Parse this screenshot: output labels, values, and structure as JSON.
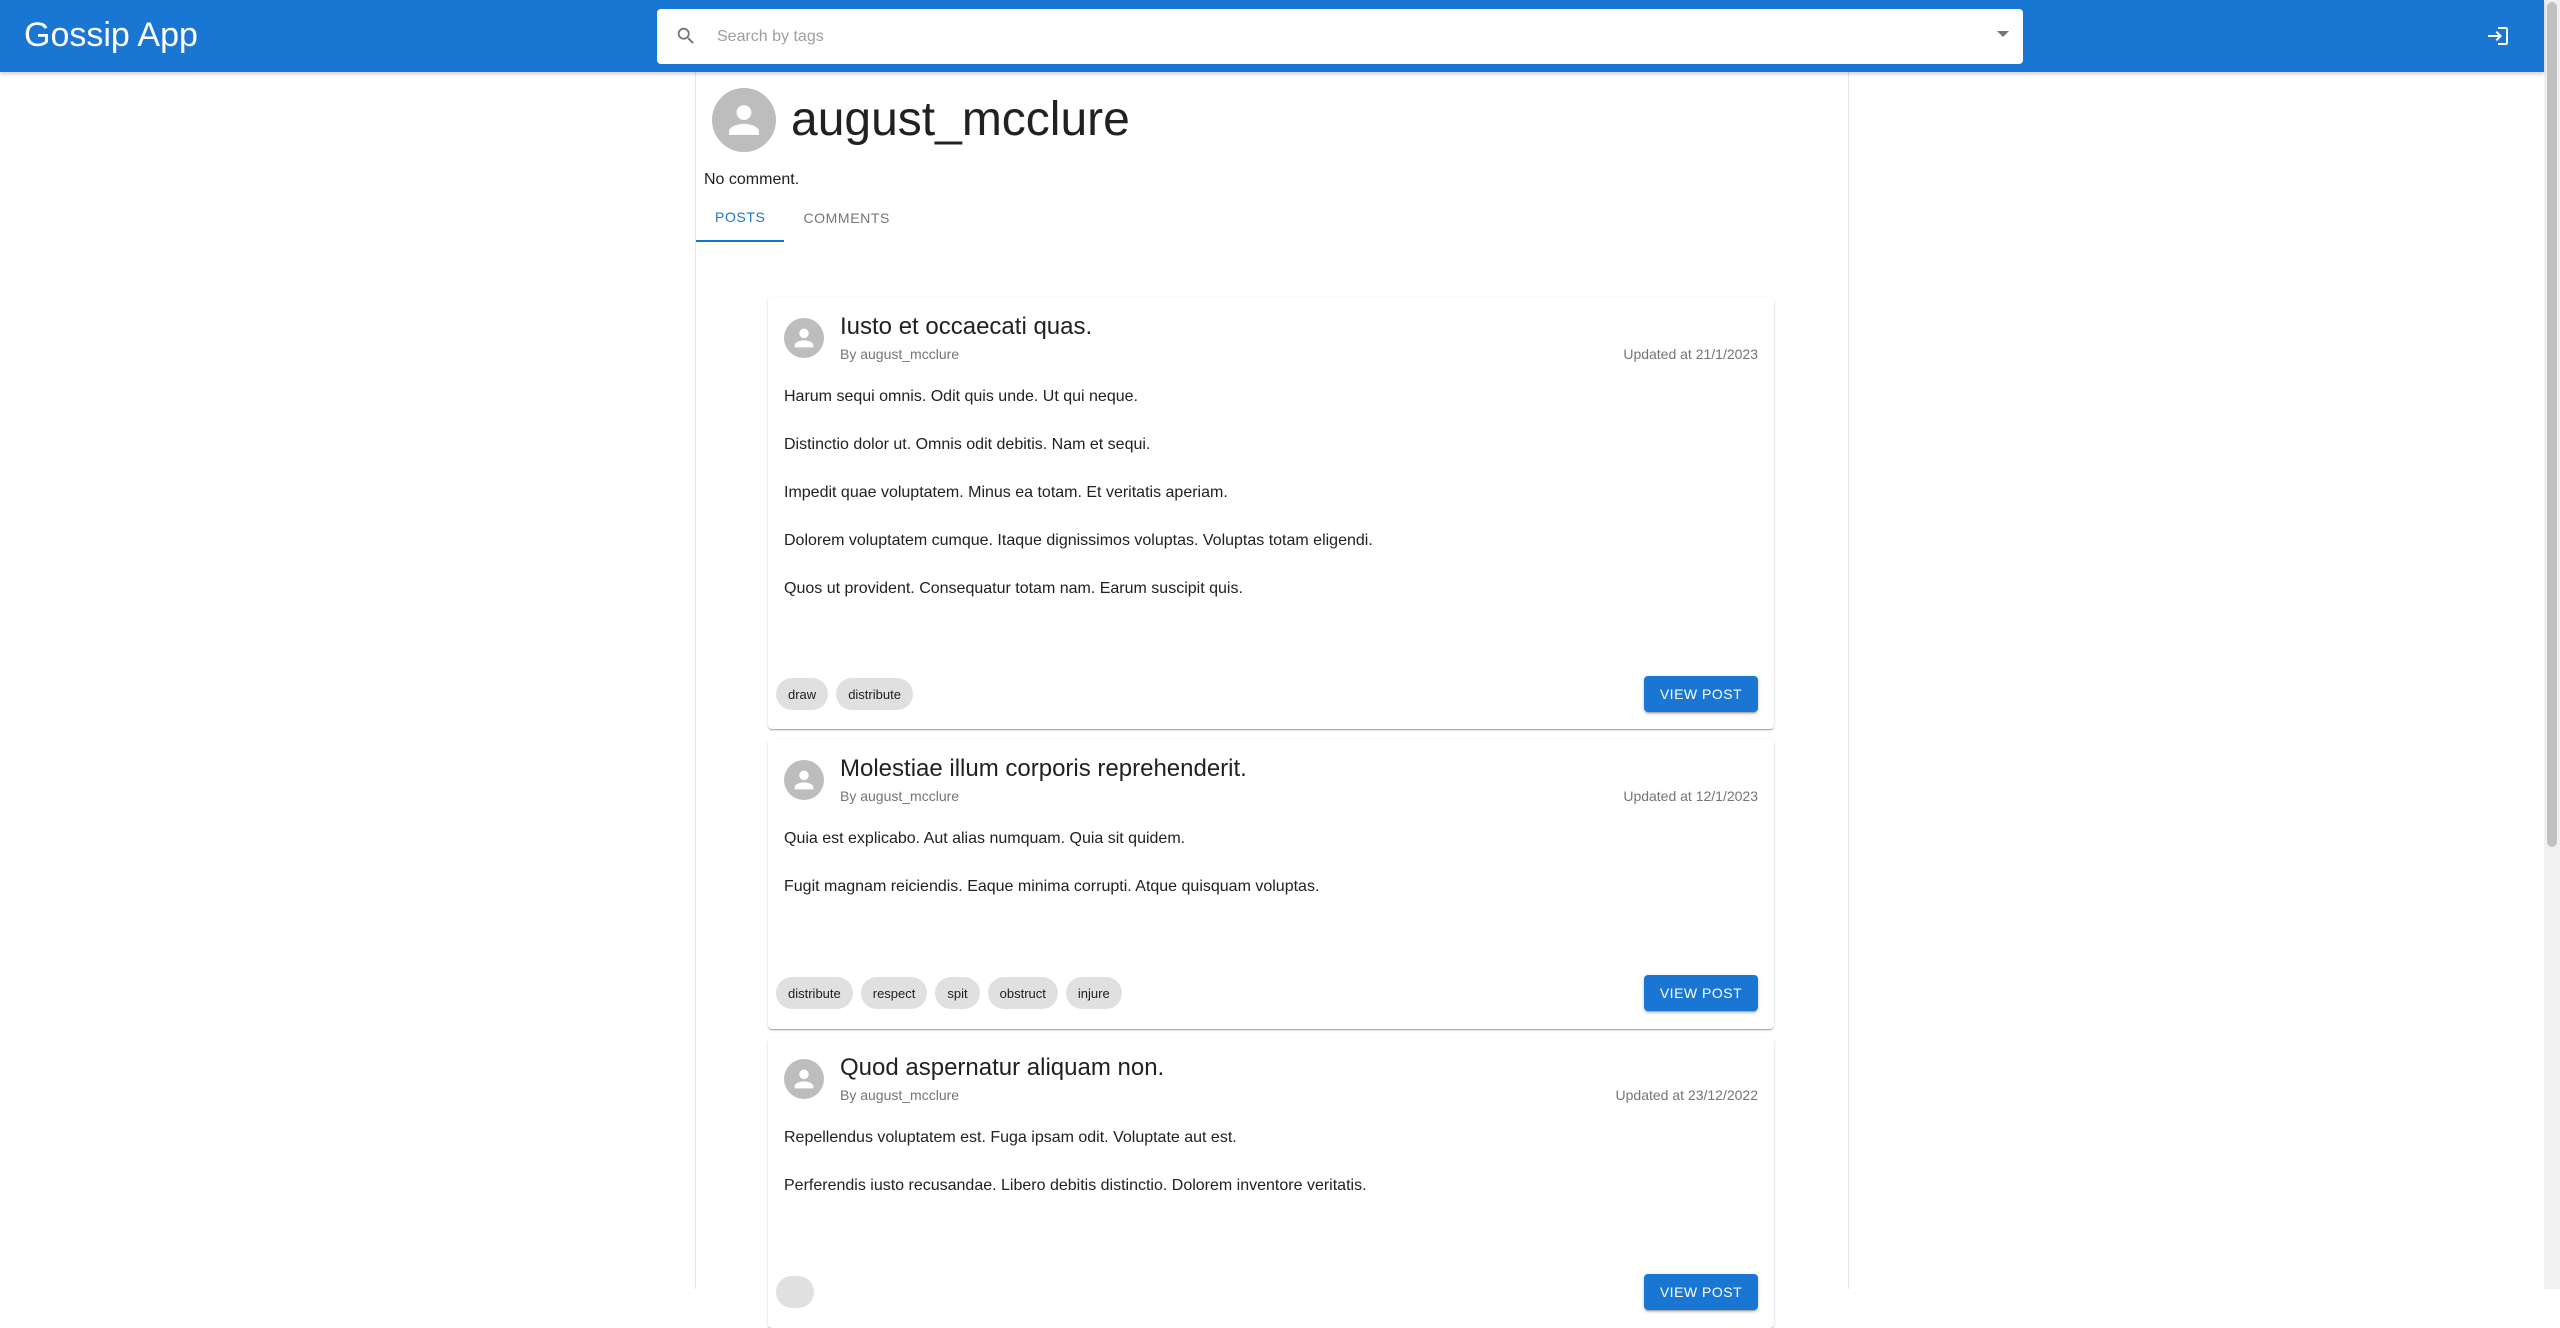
{
  "app": {
    "title": "Gossip App"
  },
  "search": {
    "placeholder": "Search by tags",
    "value": ""
  },
  "profile": {
    "username": "august_mcclure",
    "bio": "No comment."
  },
  "tabs": [
    {
      "label": "Posts",
      "active": true
    },
    {
      "label": "Comments",
      "active": false
    }
  ],
  "posts": [
    {
      "title": "Iusto et occaecati quas.",
      "author": "By august_mcclure",
      "updated": "Updated at 21/1/2023",
      "paragraphs": [
        "Harum sequi omnis. Odit quis unde. Ut qui neque.",
        "Distinctio dolor ut. Omnis odit debitis. Nam et sequi.",
        "Impedit quae voluptatem. Minus ea totam. Et veritatis aperiam.",
        "Dolorem voluptatem cumque. Itaque dignissimos voluptas. Voluptas totam eligendi.",
        "Quos ut provident. Consequatur totam nam. Earum suscipit quis."
      ],
      "tags": [
        "draw",
        "distribute"
      ],
      "button": "View Post"
    },
    {
      "title": "Molestiae illum corporis reprehenderit.",
      "author": "By august_mcclure",
      "updated": "Updated at 12/1/2023",
      "paragraphs": [
        "Quia est explicabo. Aut alias numquam. Quia sit quidem.",
        "Fugit magnam reiciendis. Eaque minima corrupti. Atque quisquam voluptas."
      ],
      "tags": [
        "distribute",
        "respect",
        "spit",
        "obstruct",
        "injure"
      ],
      "button": "View Post"
    },
    {
      "title": "Quod aspernatur aliquam non.",
      "author": "By august_mcclure",
      "updated": "Updated at 23/12/2022",
      "paragraphs": [
        "Repellendus voluptatem est. Fuga ipsam odit. Voluptate aut est.",
        "Perferendis iusto recusandae. Libero debitis distinctio. Dolorem inventore veritatis."
      ],
      "tags": [],
      "button": "View Post"
    }
  ],
  "icons": {
    "search": "search-icon",
    "dropdown": "arrow-drop-down-icon",
    "login": "login-icon",
    "avatar": "person-icon"
  },
  "colors": {
    "primary": "#1976d2",
    "chip": "#e0e0e0",
    "avatar": "#bdbdbd"
  }
}
